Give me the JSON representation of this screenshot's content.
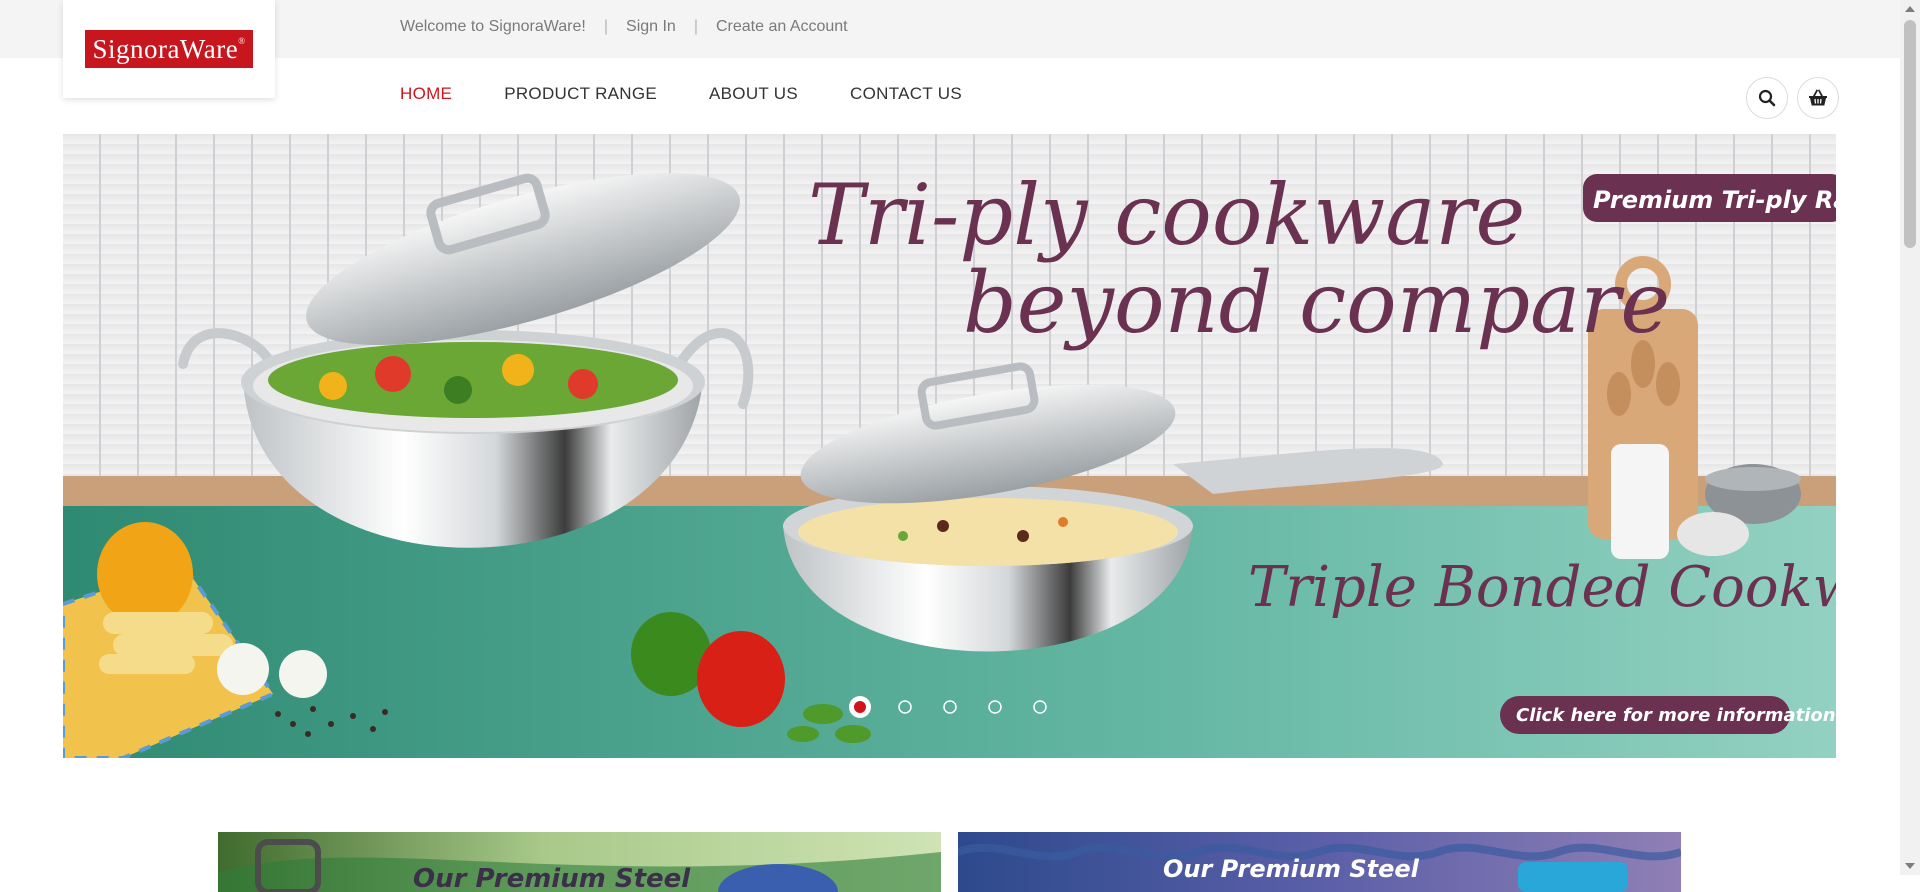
{
  "brand": {
    "logo_text": "SignoraWare",
    "logo_mark": "®",
    "color": "#c8161e"
  },
  "topbar": {
    "welcome": "Welcome to SignoraWare!",
    "sign_in": "Sign In",
    "create_account": "Create an Account"
  },
  "nav": {
    "home": "HOME",
    "product_range": "PRODUCT RANGE",
    "about_us": "ABOUT US",
    "contact_us": "CONTACT US",
    "active_color": "#d0141c"
  },
  "icons": {
    "search": "search-icon",
    "cart": "basket-icon"
  },
  "hero": {
    "headline_line1": "Tri-ply cookware",
    "headline_line2": "beyond compare",
    "badge": "Premium Tri-ply Range",
    "subline": "Triple Bonded Cookware",
    "cta": "Click here for more information",
    "slides_total": 5,
    "active_slide": 1,
    "accent": "#6b3150"
  },
  "promo": {
    "left_title": "Our Premium Steel",
    "right_title": "Our Premium Steel"
  }
}
